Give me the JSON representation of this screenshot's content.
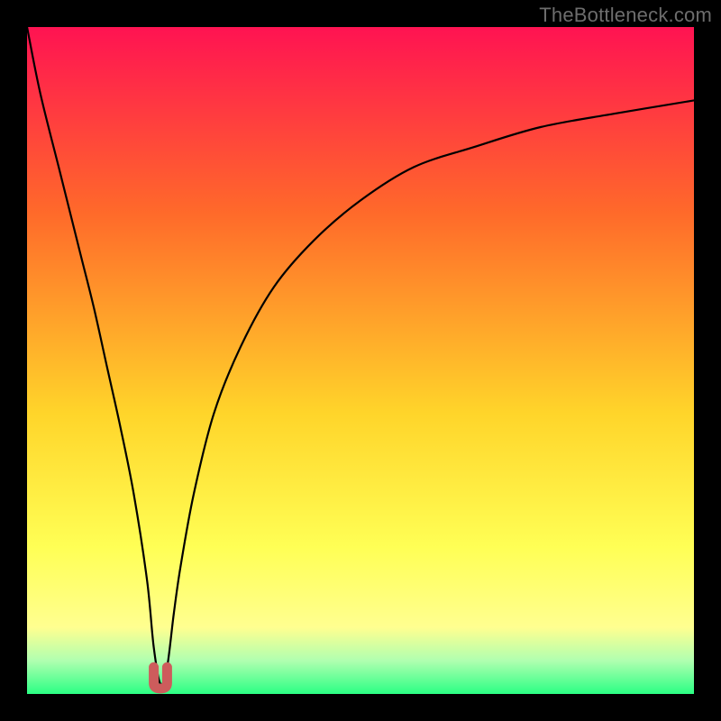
{
  "watermark": "TheBottleneck.com",
  "colors": {
    "frame": "#000000",
    "gradient_top": "#ff1352",
    "gradient_mid1": "#ff6a2a",
    "gradient_mid2": "#ffd52a",
    "gradient_mid3": "#ffff55",
    "gradient_mid4": "#ffff90",
    "gradient_bottom1": "#b0ffb0",
    "gradient_bottom2": "#2bff84",
    "curve_color": "#000000",
    "marker_color": "#cd5c5c"
  },
  "chart_data": {
    "type": "line",
    "title": "",
    "xlabel": "",
    "ylabel": "",
    "xlim": [
      0,
      100
    ],
    "ylim": [
      0,
      100
    ],
    "optimum_x": 20,
    "bottleneck_pct_at_optimum": 0,
    "series": [
      {
        "name": "bottleneck-curve",
        "x": [
          0,
          2,
          5,
          8,
          10,
          12,
          14,
          16,
          18,
          19,
          20,
          21,
          22,
          23,
          25,
          28,
          32,
          37,
          43,
          50,
          58,
          67,
          77,
          88,
          100
        ],
        "values": [
          100,
          90,
          78,
          66,
          58,
          49,
          40,
          30,
          17,
          7,
          1.5,
          4,
          12,
          19,
          30,
          42,
          52,
          61,
          68,
          74,
          79,
          82,
          85,
          87,
          89
        ]
      }
    ],
    "marker": {
      "name": "optimum-marker",
      "x_range": [
        19,
        21
      ],
      "y_range": [
        0,
        4
      ]
    },
    "legend": false,
    "grid": false
  }
}
